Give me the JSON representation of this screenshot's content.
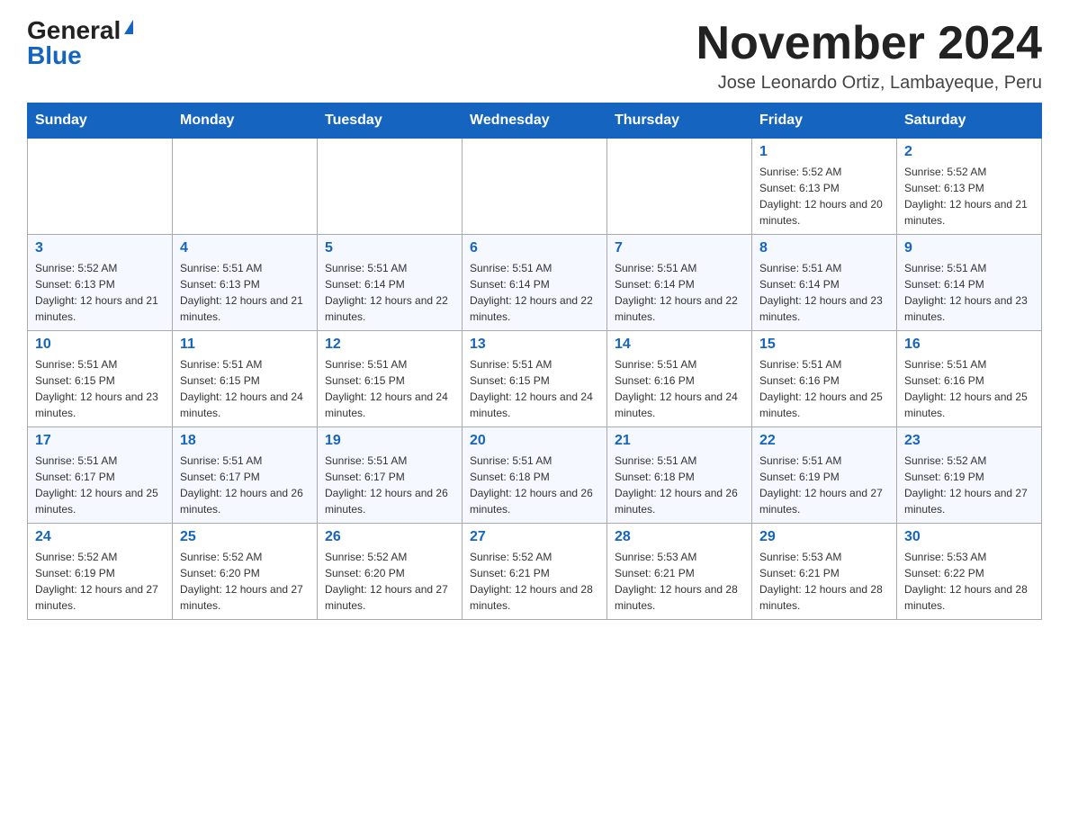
{
  "logo": {
    "general": "General",
    "blue": "Blue"
  },
  "header": {
    "month_title": "November 2024",
    "location": "Jose Leonardo Ortiz, Lambayeque, Peru"
  },
  "weekdays": [
    "Sunday",
    "Monday",
    "Tuesday",
    "Wednesday",
    "Thursday",
    "Friday",
    "Saturday"
  ],
  "weeks": [
    [
      {
        "day": "",
        "sunrise": "",
        "sunset": "",
        "daylight": ""
      },
      {
        "day": "",
        "sunrise": "",
        "sunset": "",
        "daylight": ""
      },
      {
        "day": "",
        "sunrise": "",
        "sunset": "",
        "daylight": ""
      },
      {
        "day": "",
        "sunrise": "",
        "sunset": "",
        "daylight": ""
      },
      {
        "day": "",
        "sunrise": "",
        "sunset": "",
        "daylight": ""
      },
      {
        "day": "1",
        "sunrise": "Sunrise: 5:52 AM",
        "sunset": "Sunset: 6:13 PM",
        "daylight": "Daylight: 12 hours and 20 minutes."
      },
      {
        "day": "2",
        "sunrise": "Sunrise: 5:52 AM",
        "sunset": "Sunset: 6:13 PM",
        "daylight": "Daylight: 12 hours and 21 minutes."
      }
    ],
    [
      {
        "day": "3",
        "sunrise": "Sunrise: 5:52 AM",
        "sunset": "Sunset: 6:13 PM",
        "daylight": "Daylight: 12 hours and 21 minutes."
      },
      {
        "day": "4",
        "sunrise": "Sunrise: 5:51 AM",
        "sunset": "Sunset: 6:13 PM",
        "daylight": "Daylight: 12 hours and 21 minutes."
      },
      {
        "day": "5",
        "sunrise": "Sunrise: 5:51 AM",
        "sunset": "Sunset: 6:14 PM",
        "daylight": "Daylight: 12 hours and 22 minutes."
      },
      {
        "day": "6",
        "sunrise": "Sunrise: 5:51 AM",
        "sunset": "Sunset: 6:14 PM",
        "daylight": "Daylight: 12 hours and 22 minutes."
      },
      {
        "day": "7",
        "sunrise": "Sunrise: 5:51 AM",
        "sunset": "Sunset: 6:14 PM",
        "daylight": "Daylight: 12 hours and 22 minutes."
      },
      {
        "day": "8",
        "sunrise": "Sunrise: 5:51 AM",
        "sunset": "Sunset: 6:14 PM",
        "daylight": "Daylight: 12 hours and 23 minutes."
      },
      {
        "day": "9",
        "sunrise": "Sunrise: 5:51 AM",
        "sunset": "Sunset: 6:14 PM",
        "daylight": "Daylight: 12 hours and 23 minutes."
      }
    ],
    [
      {
        "day": "10",
        "sunrise": "Sunrise: 5:51 AM",
        "sunset": "Sunset: 6:15 PM",
        "daylight": "Daylight: 12 hours and 23 minutes."
      },
      {
        "day": "11",
        "sunrise": "Sunrise: 5:51 AM",
        "sunset": "Sunset: 6:15 PM",
        "daylight": "Daylight: 12 hours and 24 minutes."
      },
      {
        "day": "12",
        "sunrise": "Sunrise: 5:51 AM",
        "sunset": "Sunset: 6:15 PM",
        "daylight": "Daylight: 12 hours and 24 minutes."
      },
      {
        "day": "13",
        "sunrise": "Sunrise: 5:51 AM",
        "sunset": "Sunset: 6:15 PM",
        "daylight": "Daylight: 12 hours and 24 minutes."
      },
      {
        "day": "14",
        "sunrise": "Sunrise: 5:51 AM",
        "sunset": "Sunset: 6:16 PM",
        "daylight": "Daylight: 12 hours and 24 minutes."
      },
      {
        "day": "15",
        "sunrise": "Sunrise: 5:51 AM",
        "sunset": "Sunset: 6:16 PM",
        "daylight": "Daylight: 12 hours and 25 minutes."
      },
      {
        "day": "16",
        "sunrise": "Sunrise: 5:51 AM",
        "sunset": "Sunset: 6:16 PM",
        "daylight": "Daylight: 12 hours and 25 minutes."
      }
    ],
    [
      {
        "day": "17",
        "sunrise": "Sunrise: 5:51 AM",
        "sunset": "Sunset: 6:17 PM",
        "daylight": "Daylight: 12 hours and 25 minutes."
      },
      {
        "day": "18",
        "sunrise": "Sunrise: 5:51 AM",
        "sunset": "Sunset: 6:17 PM",
        "daylight": "Daylight: 12 hours and 26 minutes."
      },
      {
        "day": "19",
        "sunrise": "Sunrise: 5:51 AM",
        "sunset": "Sunset: 6:17 PM",
        "daylight": "Daylight: 12 hours and 26 minutes."
      },
      {
        "day": "20",
        "sunrise": "Sunrise: 5:51 AM",
        "sunset": "Sunset: 6:18 PM",
        "daylight": "Daylight: 12 hours and 26 minutes."
      },
      {
        "day": "21",
        "sunrise": "Sunrise: 5:51 AM",
        "sunset": "Sunset: 6:18 PM",
        "daylight": "Daylight: 12 hours and 26 minutes."
      },
      {
        "day": "22",
        "sunrise": "Sunrise: 5:51 AM",
        "sunset": "Sunset: 6:19 PM",
        "daylight": "Daylight: 12 hours and 27 minutes."
      },
      {
        "day": "23",
        "sunrise": "Sunrise: 5:52 AM",
        "sunset": "Sunset: 6:19 PM",
        "daylight": "Daylight: 12 hours and 27 minutes."
      }
    ],
    [
      {
        "day": "24",
        "sunrise": "Sunrise: 5:52 AM",
        "sunset": "Sunset: 6:19 PM",
        "daylight": "Daylight: 12 hours and 27 minutes."
      },
      {
        "day": "25",
        "sunrise": "Sunrise: 5:52 AM",
        "sunset": "Sunset: 6:20 PM",
        "daylight": "Daylight: 12 hours and 27 minutes."
      },
      {
        "day": "26",
        "sunrise": "Sunrise: 5:52 AM",
        "sunset": "Sunset: 6:20 PM",
        "daylight": "Daylight: 12 hours and 27 minutes."
      },
      {
        "day": "27",
        "sunrise": "Sunrise: 5:52 AM",
        "sunset": "Sunset: 6:21 PM",
        "daylight": "Daylight: 12 hours and 28 minutes."
      },
      {
        "day": "28",
        "sunrise": "Sunrise: 5:53 AM",
        "sunset": "Sunset: 6:21 PM",
        "daylight": "Daylight: 12 hours and 28 minutes."
      },
      {
        "day": "29",
        "sunrise": "Sunrise: 5:53 AM",
        "sunset": "Sunset: 6:21 PM",
        "daylight": "Daylight: 12 hours and 28 minutes."
      },
      {
        "day": "30",
        "sunrise": "Sunrise: 5:53 AM",
        "sunset": "Sunset: 6:22 PM",
        "daylight": "Daylight: 12 hours and 28 minutes."
      }
    ]
  ]
}
